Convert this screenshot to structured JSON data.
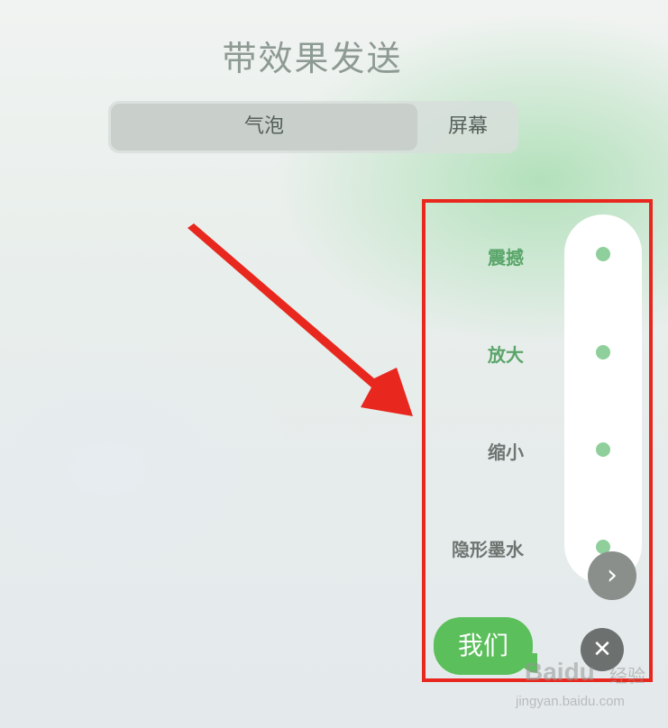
{
  "screen": {
    "title": "带效果发送"
  },
  "tabs": [
    {
      "label": "气泡",
      "selected": true
    },
    {
      "label": "屏幕",
      "selected": false
    }
  ],
  "effects": [
    {
      "label": "震撼",
      "selected": true
    },
    {
      "label": "放大",
      "selected": false
    },
    {
      "label": "缩小",
      "selected": false
    },
    {
      "label": "隐形墨水",
      "selected": false
    }
  ],
  "message": {
    "text": "我们"
  },
  "controls": {
    "send_icon": "chevron-right-icon",
    "cancel_icon": "close-icon",
    "send_glyph": "›",
    "cancel_glyph": "✕"
  },
  "watermark": {
    "brand": "Baidu",
    "brand_cn": "经验",
    "url": "jingyan.baidu.com"
  },
  "colors": {
    "accent": "#5bbf5b",
    "annotation": "#e8281e",
    "selected_label": "#5aa56a"
  }
}
